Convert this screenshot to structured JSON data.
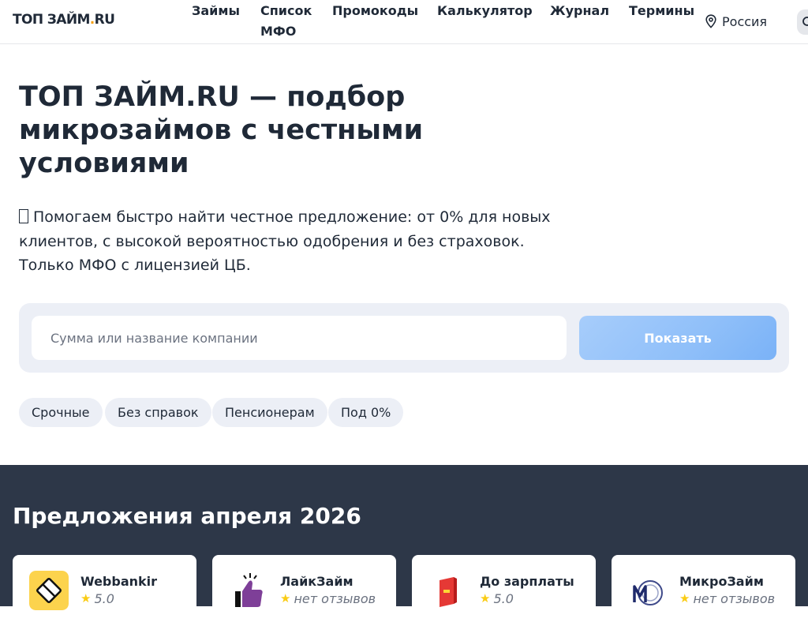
{
  "header": {
    "logo_main": "ТОП ЗАЙМ",
    "logo_dot": ".",
    "logo_tld": "RU",
    "nav": [
      "Займы",
      "Список МФО",
      "Промокоды",
      "Калькулятор",
      "Журнал",
      "Термины"
    ],
    "region": "Россия"
  },
  "hero": {
    "title": "ТОП ЗАЙМ.RU — подбор микрозаймов с честными условиями",
    "description": "Помогаем быстро найти честное предложение: от 0% для новых клиентов, с высокой вероятностью одобрения и без страховок. Только МФО с лицензией ЦБ."
  },
  "search": {
    "placeholder": "Сумма или название компании",
    "button_label": "Показать"
  },
  "chips": [
    "Срочные",
    "Без справок",
    "Пенсионерам",
    "Под 0%"
  ],
  "offers": {
    "title": "Предложения апреля 2026",
    "cards": [
      {
        "name": "Webbankir",
        "rating": "5.0",
        "logo_icon": "webbankir-logo-icon"
      },
      {
        "name": "ЛайкЗайм",
        "rating": "нет отзывов",
        "logo_icon": "like-thumb-logo-icon"
      },
      {
        "name": "До зарплаты",
        "rating": "5.0",
        "logo_icon": "dozarplaty-logo-icon"
      },
      {
        "name": "МикроЗайм",
        "rating": "нет отзывов",
        "logo_icon": "mikrozaim-logo-icon"
      }
    ]
  },
  "colors": {
    "accent": "#f59e0b",
    "button_gradient_start": "#a7cdfb",
    "button_gradient_end": "#7ab2f7",
    "offers_background": "#2d3748",
    "star": "#facc15"
  }
}
